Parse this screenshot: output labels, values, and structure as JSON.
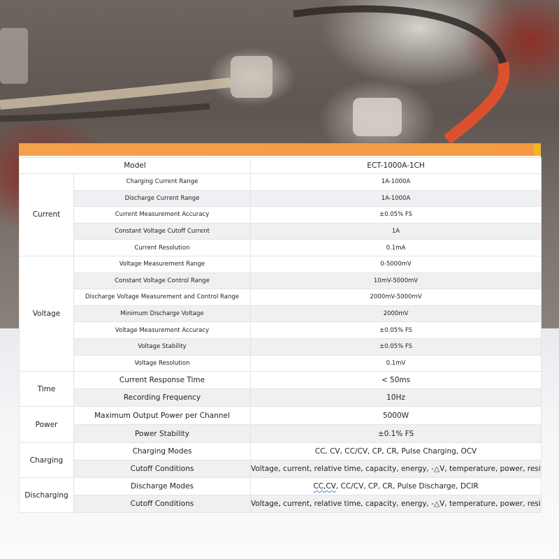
{
  "colors": {
    "accent_bar": "#f5a04e",
    "accent_tab": "#f0b624",
    "row_shade": "#eff0f2",
    "border": "#e2e4e7"
  },
  "table": {
    "header": {
      "label": "Model",
      "value": "ECT-1000A-1CH"
    },
    "groups": [
      {
        "category": "Current",
        "rows": [
          {
            "param": "Charging Current Range",
            "value": "1A-1000A"
          },
          {
            "param": "Discharge Current Range",
            "value": "1A-1000A"
          },
          {
            "param": "Current Measurement Accuracy",
            "value": "±0.05% FS"
          },
          {
            "param": "Constant Voltage Cutoff Current",
            "value": "1A"
          },
          {
            "param": "Current Resolution",
            "value": "0.1mA"
          }
        ]
      },
      {
        "category": "Voltage",
        "rows": [
          {
            "param": "Voltage Measurement Range",
            "value": "0-5000mV"
          },
          {
            "param": "Constant Voltage Control Range",
            "value": "10mV-5000mV"
          },
          {
            "param": "Discharge Voltage Measurement and Control Range",
            "value": "2000mV-5000mV"
          },
          {
            "param": "Minimum Discharge Voltage",
            "value": "2000mV"
          },
          {
            "param": "Voltage Measurement Accuracy",
            "value": "±0.05% FS"
          },
          {
            "param": "Voltage Stability",
            "value": "±0.05% FS"
          },
          {
            "param": "Voltage Resolution",
            "value": "0.1mV"
          }
        ]
      },
      {
        "category": "Time",
        "rows": [
          {
            "param": "Current Response Time",
            "value": "< 50ms"
          },
          {
            "param": "Recording Frequency",
            "value": "10Hz"
          }
        ]
      },
      {
        "category": "Power",
        "rows": [
          {
            "param": "Maximum Output Power per Channel",
            "value": "5000W"
          },
          {
            "param": "Power Stability",
            "value": "±0.1% FS"
          }
        ]
      },
      {
        "category": "Charging",
        "rows": [
          {
            "param": "Charging Modes",
            "value": "CC, CV, CC/CV, CP, CR, Pulse Charging, OCV"
          },
          {
            "param": "Cutoff Conditions",
            "value": "Voltage, current, relative time, capacity, energy, -△V, temperature, power, resistance"
          }
        ]
      },
      {
        "category": "Discharging",
        "rows": [
          {
            "param": "Discharge Modes",
            "value_prefix": "CC,CV",
            "value_rest": ", CC/CV, CP, CR, Pulse Discharge, DCIR"
          },
          {
            "param": "Cutoff Conditions",
            "value": "Voltage, current, relative time, capacity, energy, -△V, temperature, power, resistance"
          }
        ]
      }
    ]
  }
}
